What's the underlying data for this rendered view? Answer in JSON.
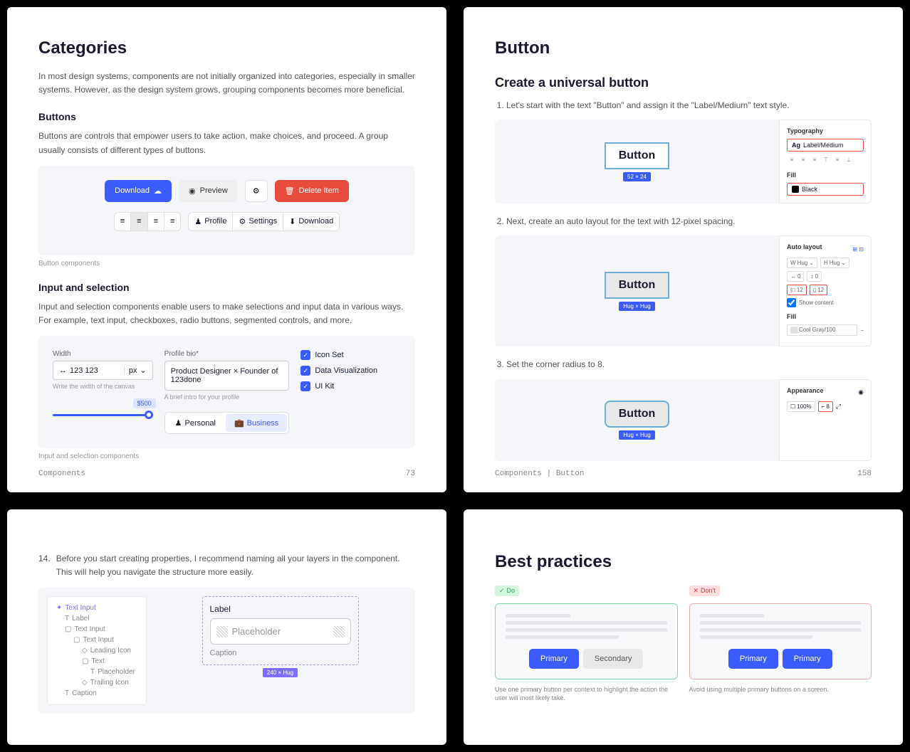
{
  "page1": {
    "title": "Categories",
    "intro": "In most design systems, components are not initially organized into categories, especially in smaller systems. However, as the design system grows, grouping components becomes more beneficial.",
    "buttons_heading": "Buttons",
    "buttons_desc": "Buttons are controls that empower users to take action, make choices, and proceed. A group usually consists of different types of buttons.",
    "buttons_caption": "Button components",
    "btn_download": "Download",
    "btn_preview": "Preview",
    "btn_delete": "Delete Item",
    "seg_profile": "Profile",
    "seg_settings": "Settings",
    "seg_download": "Download",
    "input_heading": "Input and selection",
    "input_desc": "Input and selection components enable users to make selections and input data in various ways. For example, text input, checkboxes, radio buttons, segmented controls, and more.",
    "input_caption": "Input and selection components",
    "width_label": "Width",
    "width_value": "123 123",
    "width_unit": "px",
    "width_help": "Write the width of the canvas",
    "slider_value": "$500",
    "bio_label": "Profile bio*",
    "bio_value": "Product Designer × Founder of 123done",
    "bio_help": "A brief intro for your profile",
    "check1": "Icon Set",
    "check2": "Data Visualization",
    "check3": "UI Kit",
    "tab_personal": "Personal",
    "tab_business": "Business",
    "footer_left": "Components",
    "footer_right": "73"
  },
  "page2": {
    "title": "Button",
    "subtitle": "Create a universal button",
    "step1": "Let's start with the text \"Button\" and assign it the \"Label/Medium\" text style.",
    "step2": "Next, create an auto layout for the text with 12-pixel spacing.",
    "step3": "Set the corner radius to 8.",
    "preview_text": "Button",
    "badge1": "52 × 24",
    "badge2": "Hug × Hug",
    "badge3": "Hug × Hug",
    "typo_label": "Typography",
    "typo_style": "Label/Medium",
    "typo_prefix": "Ag",
    "fill_label": "Fill",
    "fill_value": "Black",
    "auto_label": "Auto layout",
    "hug": "Hug",
    "spacing_h": "0",
    "spacing_v": "0",
    "padding_h": "12",
    "padding_v": "12",
    "show_content": "Show content",
    "fill2_label": "Fill",
    "fill2_value": "Cool Gray/100",
    "appearance_label": "Appearance",
    "opacity": "100%",
    "radius": "8",
    "footer_left": "Components | Button",
    "footer_right": "158"
  },
  "page3": {
    "step14_num": "14.",
    "step14": "Before you start creating properties, I recommend naming all your layers in the component. This will help you navigate the structure more easily.",
    "tree": {
      "l1": "Text Input",
      "l2a": "Label",
      "l2b": "Text Input",
      "l3a": "Text Input",
      "l4a": "Leading Icon",
      "l4b": "Text",
      "l4c": "Placeholder",
      "l4d": "Trailing Icon",
      "l2c": "Caption"
    },
    "preview_label": "Label",
    "preview_placeholder": "Placeholder",
    "preview_caption": "Caption",
    "preview_badge": "240 × Hug"
  },
  "page4": {
    "title": "Best practices",
    "do_label": "Do",
    "dont_label": "Don't",
    "primary": "Primary",
    "secondary": "Secondary",
    "do_caption": "Use one primary button per context to highlight the action the user will most likely take.",
    "dont_caption": "Avoid using multiple primary buttons on a screen."
  }
}
